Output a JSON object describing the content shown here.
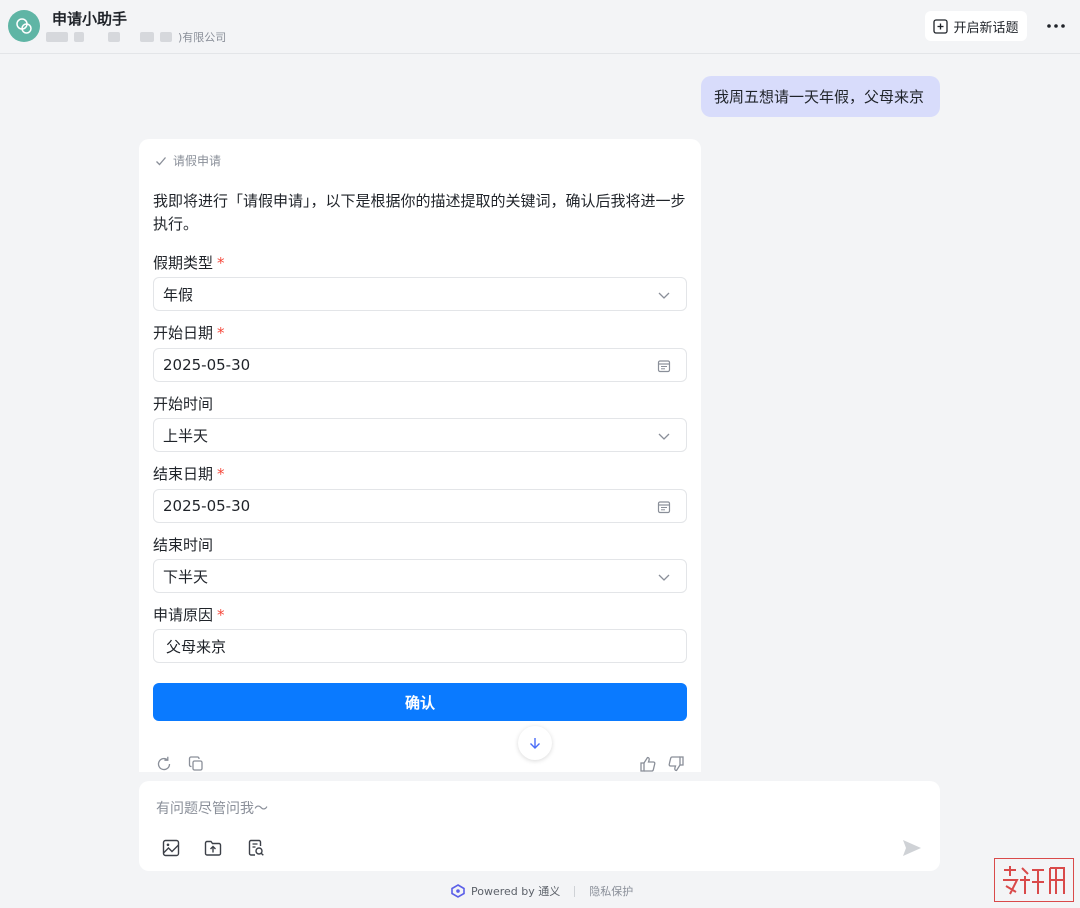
{
  "header": {
    "title": "申请小助手",
    "subtitle_suffix": ")有限公司",
    "new_topic_label": "开启新话题"
  },
  "user_message": "我周五想请一天年假，父母来京",
  "card": {
    "tag_label": "请假申请",
    "intro_text": "我即将进行「请假申请」，以下是根据你的描述提取的关键词，确认后我将进一步执行。",
    "fields": [
      {
        "label": "假期类型",
        "required": true,
        "value": "年假",
        "kind": "select"
      },
      {
        "label": "开始日期",
        "required": true,
        "value": "2025-05-30",
        "kind": "date"
      },
      {
        "label": "开始时间",
        "required": false,
        "value": "上半天",
        "kind": "select"
      },
      {
        "label": "结束日期",
        "required": true,
        "value": "2025-05-30",
        "kind": "date"
      },
      {
        "label": "结束时间",
        "required": false,
        "value": "下半天",
        "kind": "select"
      },
      {
        "label": "申请原因",
        "required": true,
        "value": "父母来京",
        "kind": "text"
      }
    ],
    "required_mark": "*",
    "confirm_label": "确认"
  },
  "input": {
    "placeholder": "有问题尽管问我～"
  },
  "footer": {
    "powered_by": "Powered by 通义",
    "privacy": "隐私保护"
  },
  "colors": {
    "accent": "#0a7aff",
    "user_bubble": "#d8dcfb",
    "avatar": "#5fb5a5",
    "required": "#f5483b"
  }
}
